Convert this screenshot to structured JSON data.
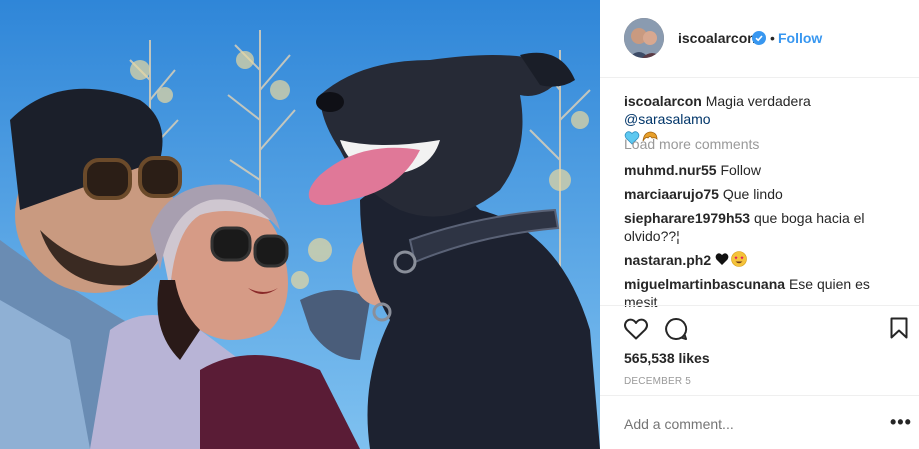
{
  "post": {
    "username": "isco­alarcon",
    "follow_label": "Follow",
    "separator": "•",
    "caption_user": "iscoalarcon",
    "caption_text": "Magia verdadera ",
    "caption_mention": "@sarasalamo",
    "load_more": "Load more comments",
    "likes": "565,538 likes",
    "date": "DECEMBER 5",
    "add_comment_placeholder": "Add a comment...",
    "more_options": "•••"
  },
  "comments": [
    {
      "user": "muhmd.nur55",
      "text": "Follow"
    },
    {
      "user": "marciaarujo75",
      "text": "Que lindo"
    },
    {
      "user": "siepharare1979h53",
      "text": "que boga hacia el olvido??¦"
    },
    {
      "user": "nastaran.ph2",
      "text": ""
    },
    {
      "user": "miguelmartinbascunana",
      "text": "Ese quien es mesit"
    }
  ],
  "colors": {
    "accent": "#3897f0",
    "muted": "#999999",
    "border": "#efefef"
  },
  "icons": {
    "like": "heart-outline-icon",
    "comment": "comment-bubble-icon",
    "save": "bookmark-icon",
    "verified": "verified-badge-icon"
  }
}
